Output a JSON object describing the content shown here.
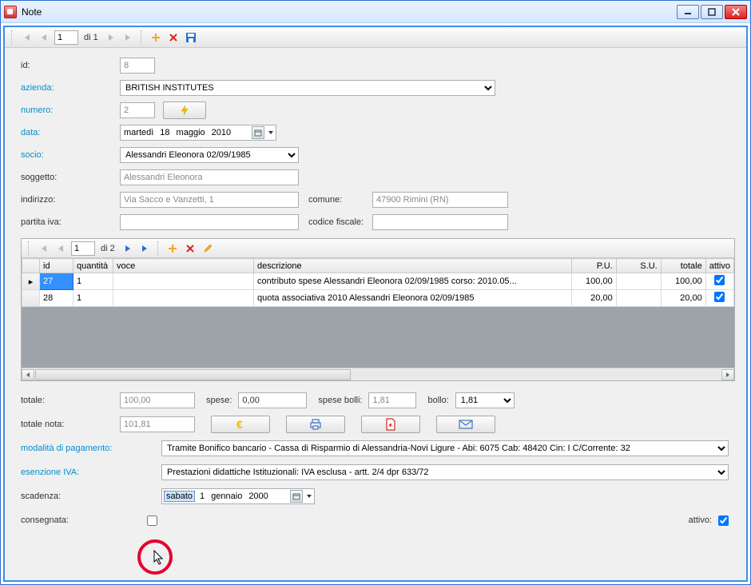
{
  "window": {
    "title": "Note"
  },
  "nav1": {
    "page": "1",
    "of_label": "di 1"
  },
  "labels": {
    "id": "id:",
    "azienda": "azienda:",
    "numero": "numero:",
    "data": "data:",
    "socio": "socio:",
    "soggetto": "soggetto:",
    "indirizzo": "indirizzo:",
    "comune": "comune:",
    "partita_iva": "partita iva:",
    "codice_fiscale": "codice fiscale:",
    "totale": "totale:",
    "spese": "spese:",
    "spese_bolli": "spese bolli:",
    "bollo": "bollo:",
    "totale_nota": "totale nota:",
    "modalita": "modalità di pagamento:",
    "esenzione": "esenzione IVA:",
    "scadenza": "scadenza:",
    "consegnata": "consegnata:",
    "attivo": "attivo:"
  },
  "fields": {
    "id": "8",
    "azienda": "BRITISH INSTITUTES",
    "numero": "2",
    "data_day_name": "martedì",
    "data_day": "18",
    "data_month": "maggio",
    "data_year": "2010",
    "socio": "Alessandri Eleonora 02/09/1985",
    "soggetto": "Alessandri Eleonora",
    "indirizzo": "Via Sacco e Vanzetti, 1",
    "comune": "47900 Rimini (RN)",
    "partita_iva": "",
    "codice_fiscale": "",
    "totale": "100,00",
    "spese": "0,00",
    "spese_bolli": "1,81",
    "bollo": "1,81",
    "totale_nota": "101,81",
    "modalita": "Tramite Bonifico bancario - Cassa di Risparmio di Alessandria-Novi Ligure - Abi: 6075 Cab: 48420 Cin: I C/Corrente: 32",
    "esenzione": "Prestazioni didattiche Istituzionali: IVA esclusa - artt. 2/4 dpr 633/72",
    "scadenza_day_name": "sabato",
    "scadenza_day": "1",
    "scadenza_month": "gennaio",
    "scadenza_year": "2000",
    "consegnata": false,
    "attivo": true
  },
  "nav2": {
    "page": "1",
    "of_label": "di 2"
  },
  "grid": {
    "headers": {
      "id": "id",
      "quantita": "quantità",
      "voce": "voce",
      "descrizione": "descrizione",
      "pu": "P.U.",
      "su": "S.U.",
      "totale": "totale",
      "attivo": "attivo"
    },
    "rows": [
      {
        "id": "27",
        "quantita": "1",
        "voce": "",
        "descrizione": "contributo spese Alessandri Eleonora 02/09/1985 corso: 2010.05...",
        "pu": "100,00",
        "su": "",
        "totale": "100,00",
        "attivo": true
      },
      {
        "id": "28",
        "quantita": "1",
        "voce": "",
        "descrizione": "quota associativa 2010 Alessandri Eleonora 02/09/1985",
        "pu": "20,00",
        "su": "",
        "totale": "20,00",
        "attivo": true
      }
    ]
  },
  "colors": {
    "accent": "#008fcf",
    "link_blue": "#2a6fd6",
    "red": "#d22"
  }
}
